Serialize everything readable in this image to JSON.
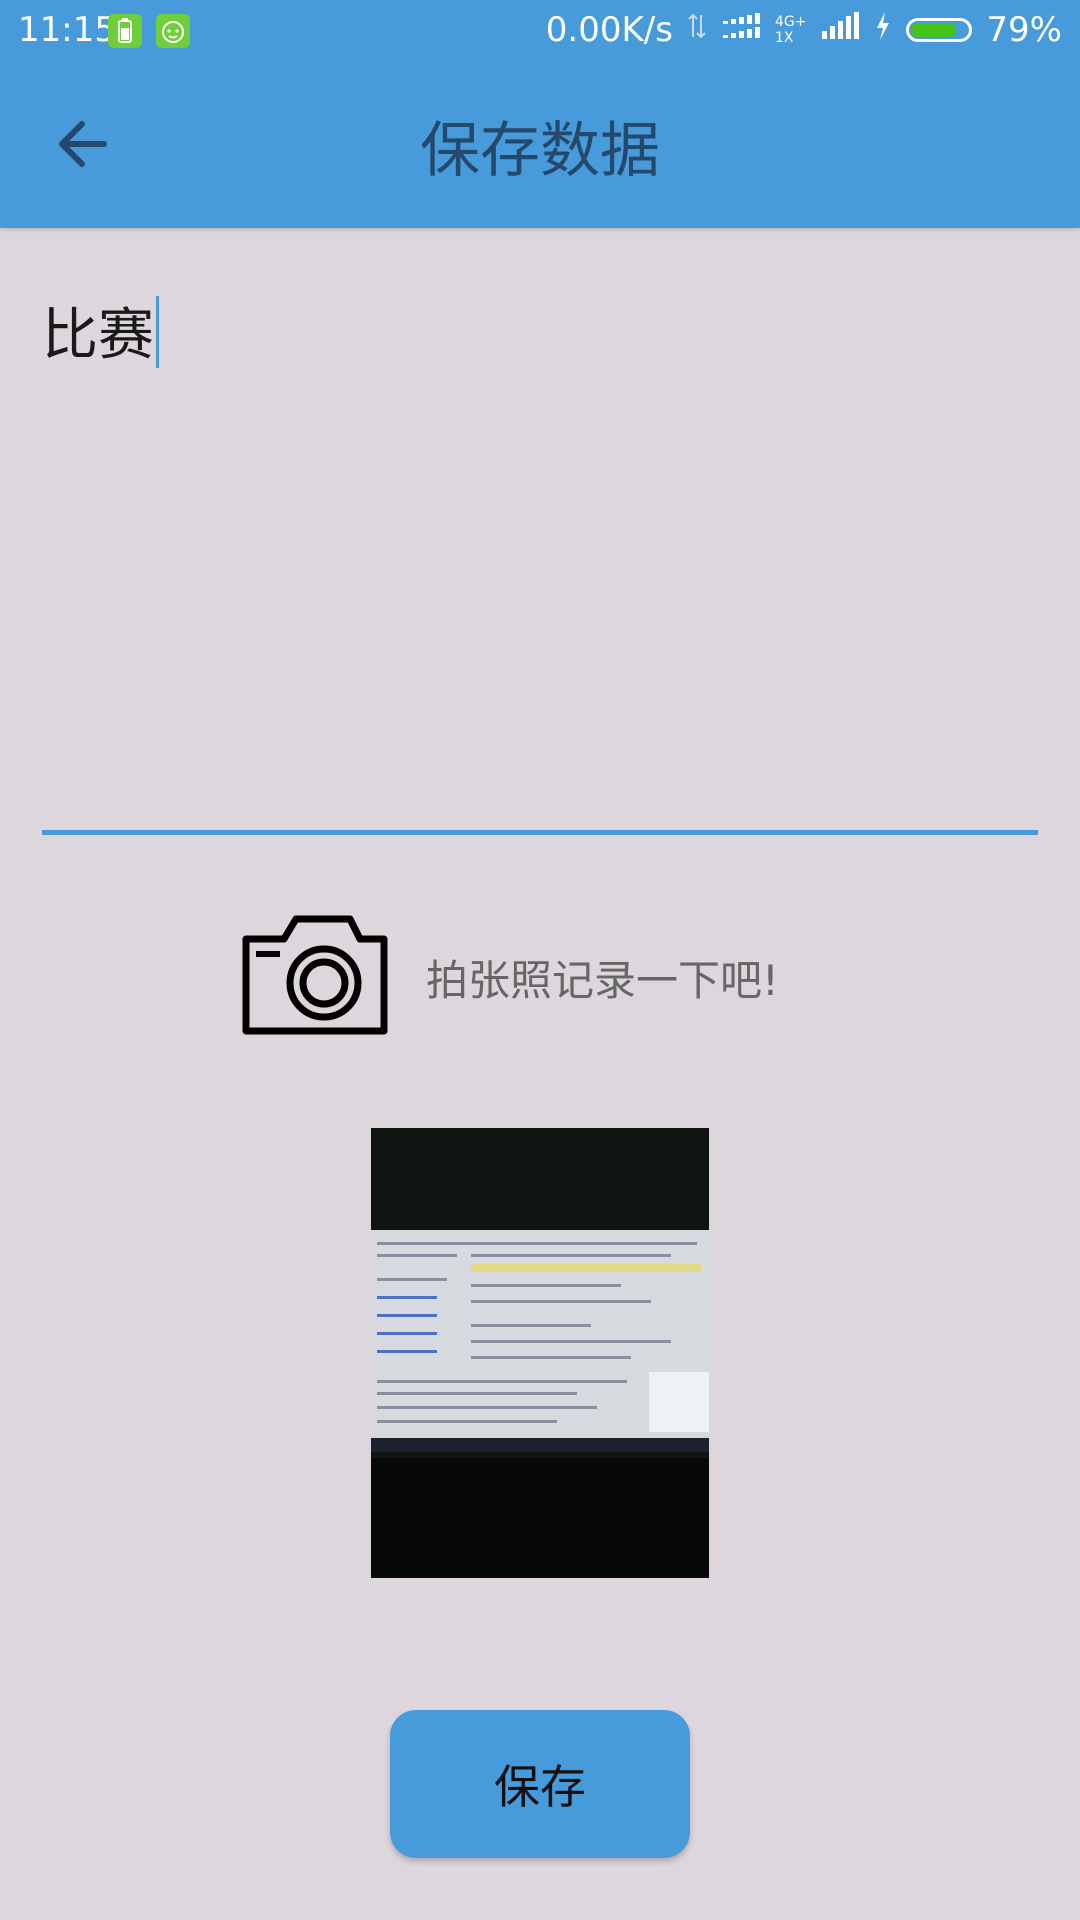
{
  "status_bar": {
    "time": "11:15",
    "network_speed": "0.00K/s",
    "network_type_top": "4G+",
    "network_type_bottom": "1X",
    "battery_percent": "79%",
    "battery_level": 0.79,
    "icons": [
      "battery-app-icon",
      "android-app-icon",
      "data-transfer-icon",
      "signal-icon",
      "signal-icon",
      "charging-icon",
      "battery-icon"
    ]
  },
  "toolbar": {
    "title": "保存数据",
    "back_icon": "arrow-left-icon"
  },
  "note": {
    "value": "比赛"
  },
  "camera": {
    "icon": "camera-icon",
    "hint": "拍张照记录一下吧!"
  },
  "photo": {
    "icon": "photo-thumbnail"
  },
  "save_button": {
    "label": "保存"
  },
  "colors": {
    "accent": "#479bdb",
    "background": "#ddd7dd",
    "title_text": "#24496c"
  }
}
